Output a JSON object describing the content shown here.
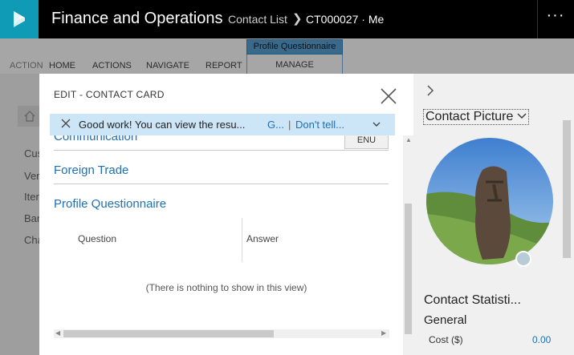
{
  "topbar": {
    "app_title": "Finance and Operations",
    "breadcrumb": [
      "Contact List",
      "CT000027 · Me"
    ],
    "more_label": "···",
    "brand_color": "#0f9bb5"
  },
  "ribbon": {
    "tabs": [
      "HOME",
      "ACTIONS",
      "NAVIGATE",
      "REPORT"
    ],
    "context_group": "Profile Questionnaire",
    "context_tab": "MANAGE"
  },
  "background": {
    "action_label": "ACTION",
    "sidebar_items": [
      "Cus",
      "Ver",
      "Iter",
      "Bar",
      "Cha"
    ]
  },
  "dialog": {
    "title": "EDIT - CONTACT CARD",
    "message": {
      "text": "Good work! You can view the resu...",
      "link1": "G...",
      "separator": "|",
      "link2": "Don't tell..."
    },
    "sections": {
      "communication": "Communication",
      "language_value": "ENU",
      "foreign_trade": "Foreign Trade",
      "profile_questionnaire": "Profile Questionnaire"
    },
    "grid": {
      "columns": [
        "Question",
        "Answer"
      ],
      "empty_text": "(There is nothing to show in this view)"
    }
  },
  "right_panel": {
    "picture_title": "Contact Picture",
    "statistics_title": "Contact Statisti...",
    "general_label": "General",
    "cost_label": "Cost ($)",
    "cost_value": "0.00"
  }
}
